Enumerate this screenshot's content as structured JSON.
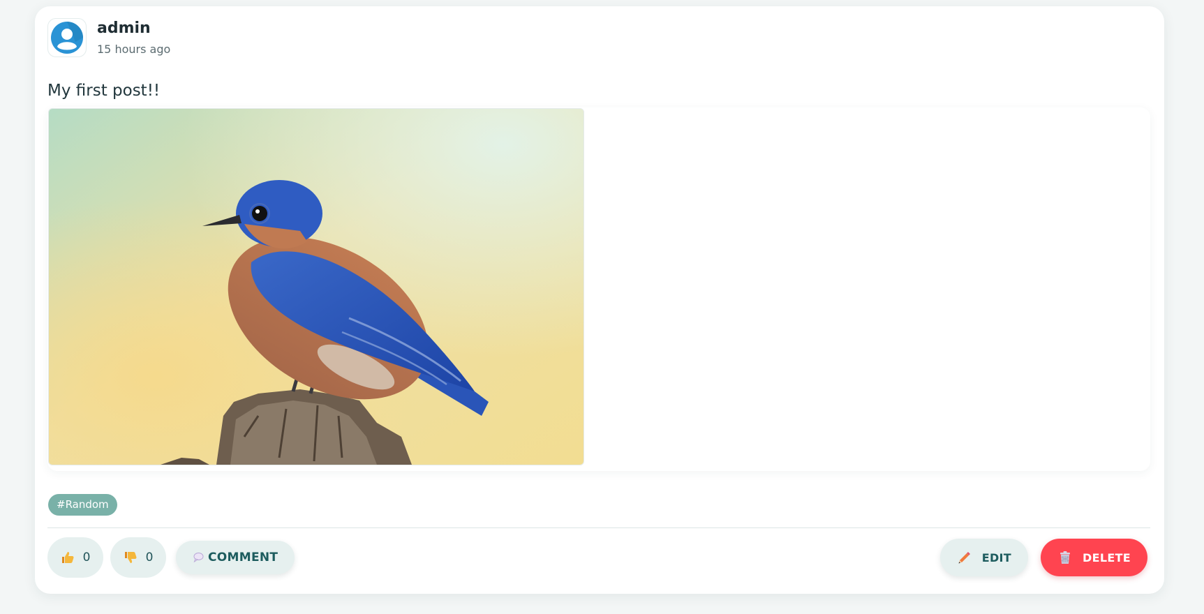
{
  "post": {
    "author": "admin",
    "time": "15 hours ago",
    "text": "My first post!!",
    "image_alt": "Eastern bluebird perched on a stump",
    "tag": "#Random"
  },
  "reactions": {
    "likes": "0",
    "dislikes": "0",
    "comment_label": "COMMENT"
  },
  "actions": {
    "edit_label": "EDIT",
    "delete_label": "DELETE"
  },
  "icons": {
    "avatar": "user-avatar-icon",
    "like": "thumbs-up-icon",
    "dislike": "thumbs-down-icon",
    "comment": "speech-bubble-icon",
    "edit": "pencil-icon",
    "delete": "trash-icon"
  },
  "colors": {
    "accent_teal": "#79b1a8",
    "delete_red": "#ff4450",
    "pill_bg": "#e6f0ef"
  }
}
